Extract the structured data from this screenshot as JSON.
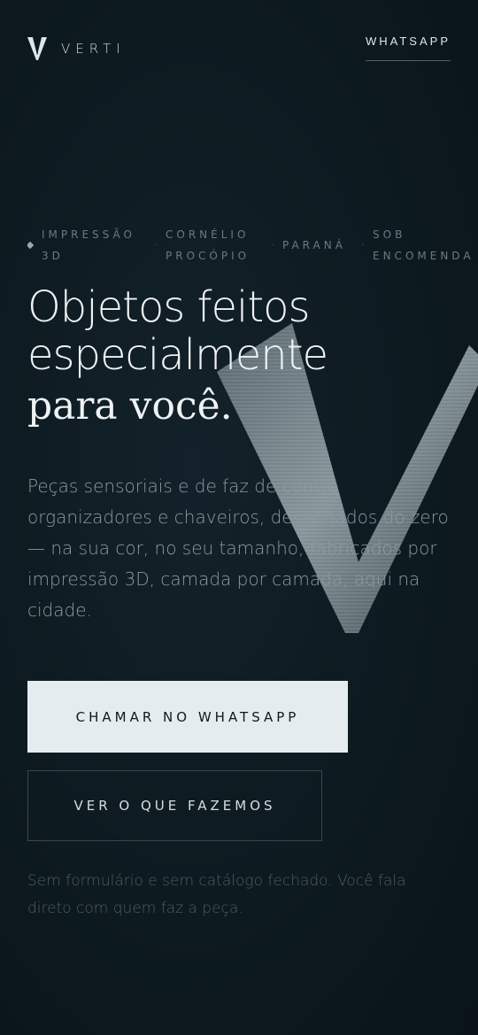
{
  "header": {
    "brand_name": "VERTI",
    "nav_whatsapp": "WHATSAPP"
  },
  "hero": {
    "tags": [
      "IMPRESSÃO 3D",
      "CORNÉLIO PROCÓPIO",
      "PARANÁ",
      "SOB ENCOMENDA"
    ],
    "tag_separator": "·",
    "headline_line1": "Objetos feitos",
    "headline_line2": "especialmente",
    "headline_line3": "para você.",
    "lead": "Peças sensoriais e de faz de conta, organizadores e chaveiros, desenhados do zero — na sua cor, no seu tamanho, fabricados por impressão 3D, camada por camada, aqui na cidade.",
    "primary_cta": "CHAMAR NO WHATSAPP",
    "secondary_cta": "VER O QUE FAZEMOS",
    "note": "Sem formulário e sem catálogo fechado. Você fala direto com quem faz a peça."
  },
  "icons": {
    "brand_logo": "v-logo-icon",
    "background_mark": "v-watermark-icon",
    "tag_marker": "diamond-icon"
  },
  "colors": {
    "background": "#0d1a20",
    "primary_button": "#e4ecef",
    "text": "#eef2f3",
    "muted_text": "#8d9aa0"
  }
}
